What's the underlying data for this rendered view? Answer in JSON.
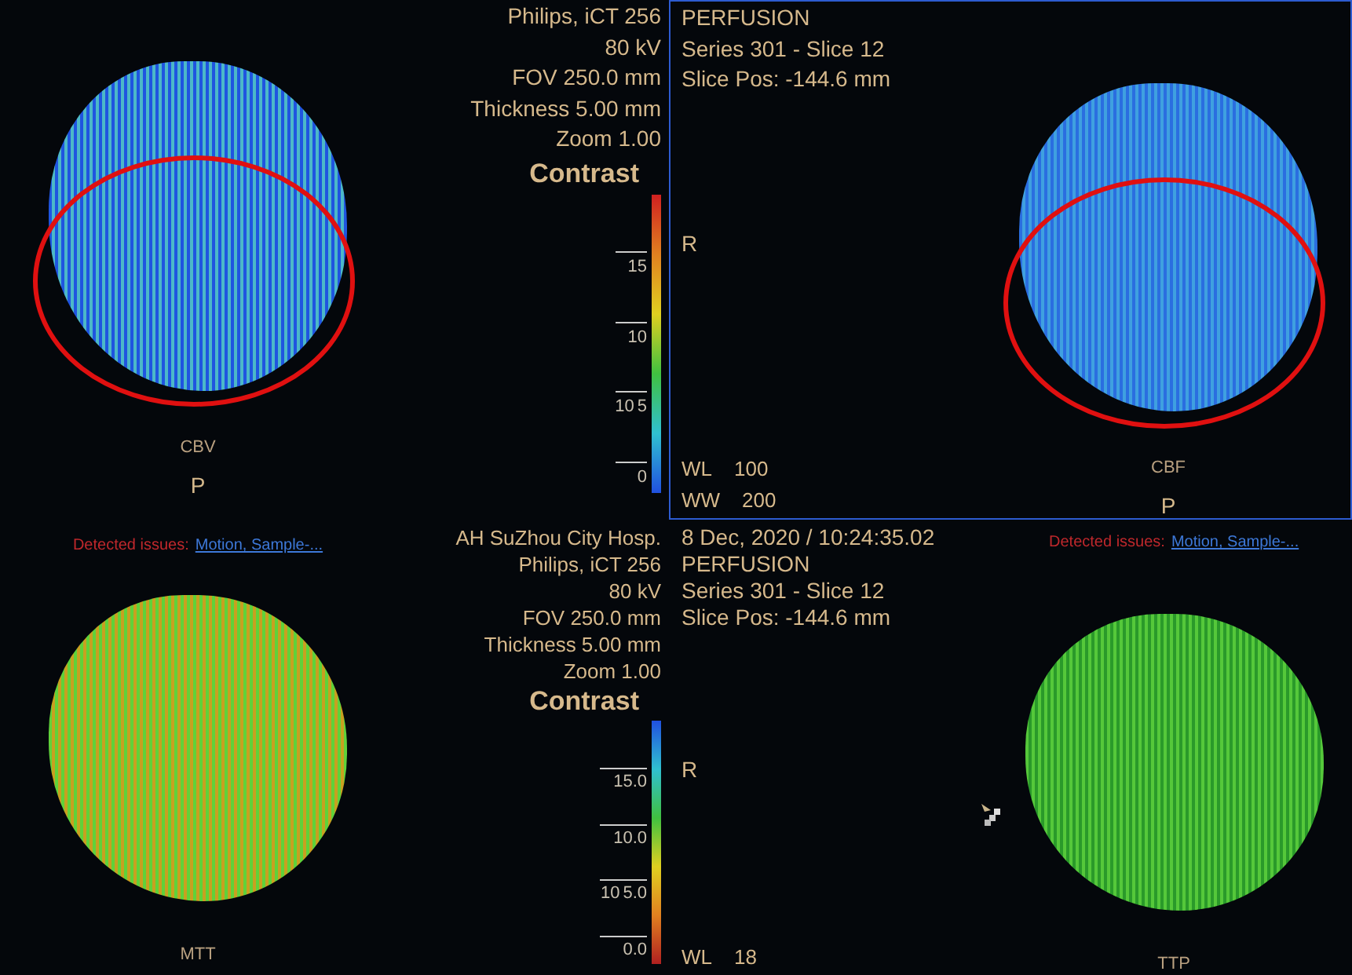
{
  "viewports": [
    {
      "kind": "left",
      "selected": false,
      "annotated": true,
      "info": [
        "Philips, iCT 256",
        "80 kV",
        "FOV 250.0 mm",
        "Thickness 5.00 mm",
        "Zoom 1.00"
      ],
      "contrast": "Contrast",
      "colorbar": {
        "inverted": false,
        "ticks": [
          {
            "label": "15"
          },
          {
            "label": "10"
          },
          {
            "label": "5",
            "note": "10"
          },
          {
            "label": "0"
          }
        ]
      },
      "map_label": "CBV",
      "bottom_marker": "P"
    },
    {
      "kind": "right",
      "selected": true,
      "annotated": true,
      "info": [
        "PERFUSION",
        "Series 301 - Slice 12",
        "Slice Pos: -144.6 mm"
      ],
      "side_marker": "R",
      "window": [
        {
          "name": "WL",
          "value": "100"
        },
        {
          "name": "WW",
          "value": "200"
        }
      ],
      "map_label": "CBF",
      "bottom_marker": "P"
    },
    {
      "kind": "left",
      "selected": false,
      "annotated": false,
      "issues": {
        "label": "Detected issues:",
        "link": "Motion, Sample-..."
      },
      "info": [
        "AH SuZhou City Hosp.",
        "Philips, iCT 256",
        "80 kV",
        "FOV 250.0 mm",
        "Thickness 5.00 mm",
        "Zoom 1.00"
      ],
      "contrast": "Contrast",
      "colorbar": {
        "inverted": true,
        "ticks": [
          {
            "label": "15.0"
          },
          {
            "label": "10.0"
          },
          {
            "label": "5.0",
            "note": "10"
          },
          {
            "label": "0.0"
          }
        ]
      },
      "map_label": "MTT"
    },
    {
      "kind": "right",
      "selected": false,
      "annotated": false,
      "cursor": true,
      "issues": {
        "label": "Detected issues:",
        "link": "Motion, Sample-..."
      },
      "info": [
        "8 Dec, 2020 / 10:24:35.02",
        "PERFUSION",
        "Series 301 - Slice 12",
        "Slice Pos: -144.6 mm"
      ],
      "side_marker": "R",
      "window": [
        {
          "name": "WL",
          "value": "18"
        }
      ],
      "map_label": "TTP"
    }
  ]
}
